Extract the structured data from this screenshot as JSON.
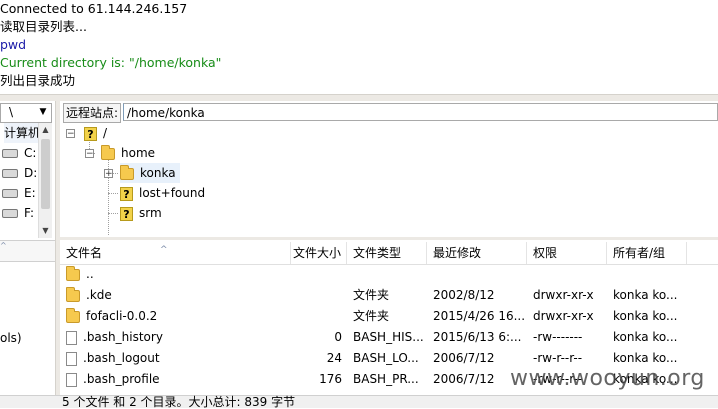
{
  "log": [
    {
      "text": "Connected to 61.144.246.157",
      "color": "black"
    },
    {
      "text": "读取目录列表...",
      "color": "black"
    },
    {
      "text": "pwd",
      "color": "blue"
    },
    {
      "text": "Current directory is: \"/home/konka\"",
      "color": "green"
    },
    {
      "text": "列出目录成功",
      "color": "black"
    }
  ],
  "local": {
    "drive_combo": "\\",
    "tree": [
      {
        "label": "计算机"
      },
      {
        "label": "C:"
      },
      {
        "label": "D:"
      },
      {
        "label": "E:"
      },
      {
        "label": "F:"
      }
    ],
    "partial_text": "ols)"
  },
  "remote": {
    "address_label": "远程站点:",
    "address_value": "/home/konka",
    "tree": [
      {
        "label": "/",
        "icon": "question-icon"
      },
      {
        "label": "home",
        "icon": "folder-icon"
      },
      {
        "label": "konka",
        "icon": "folder-icon",
        "selected": true
      },
      {
        "label": "lost+found",
        "icon": "question-icon"
      },
      {
        "label": "srm",
        "icon": "question-icon"
      }
    ],
    "columns": [
      "文件名",
      "文件大小",
      "文件类型",
      "最近修改",
      "权限",
      "所有者/组"
    ],
    "files": [
      {
        "name": "..",
        "size": "",
        "type": "",
        "modified": "",
        "perms": "",
        "owner": "",
        "icon": "folder-icon"
      },
      {
        "name": ".kde",
        "size": "",
        "type": "文件夹",
        "modified": "2002/8/12",
        "perms": "drwxr-xr-x",
        "owner": "konka ko...",
        "icon": "folder-icon"
      },
      {
        "name": "fofacli-0.0.2",
        "size": "",
        "type": "文件夹",
        "modified": "2015/4/26 16...",
        "perms": "drwxr-xr-x",
        "owner": "konka ko...",
        "icon": "folder-icon"
      },
      {
        "name": ".bash_history",
        "size": "0",
        "type": "BASH_HIS...",
        "modified": "2015/6/13 6:...",
        "perms": "-rw-------",
        "owner": "konka ko...",
        "icon": "file-icon"
      },
      {
        "name": ".bash_logout",
        "size": "24",
        "type": "BASH_LO...",
        "modified": "2006/7/12",
        "perms": "-rw-r--r--",
        "owner": "konka ko...",
        "icon": "file-icon"
      },
      {
        "name": ".bash_profile",
        "size": "176",
        "type": "BASH_PR...",
        "modified": "2006/7/12",
        "perms": "-rw-r--r--",
        "owner": "konka ko...",
        "icon": "file-icon"
      }
    ]
  },
  "status_text": "5 个文件 和 2 个目录。大小总计: 839 字节",
  "watermark": "www.wooyun.org"
}
